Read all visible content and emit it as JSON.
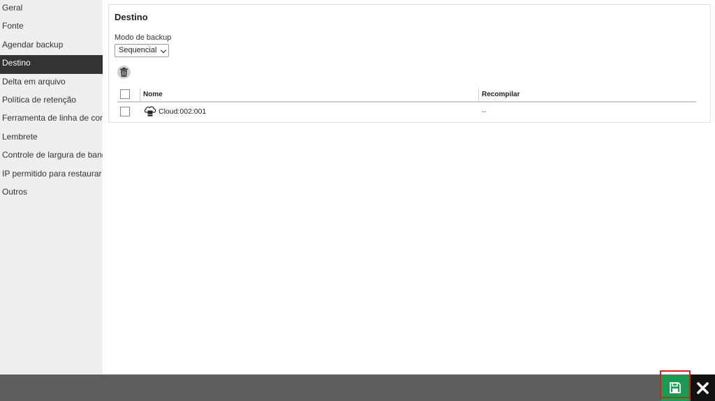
{
  "sidebar": {
    "items": [
      {
        "label": "Geral",
        "active": false
      },
      {
        "label": "Fonte",
        "active": false
      },
      {
        "label": "Agendar backup",
        "active": false
      },
      {
        "label": "Destino",
        "active": true
      },
      {
        "label": "Delta em arquivo",
        "active": false
      },
      {
        "label": "Política de retenção",
        "active": false
      },
      {
        "label": "Ferramenta de linha de coma",
        "active": false
      },
      {
        "label": "Lembrete",
        "active": false
      },
      {
        "label": "Controle de largura de band",
        "active": false
      },
      {
        "label": "IP permitido para restaurar",
        "active": false
      },
      {
        "label": "Outros",
        "active": false
      }
    ]
  },
  "panel": {
    "title": "Destino",
    "mode_label": "Modo de backup",
    "mode_value": "Sequencial"
  },
  "table": {
    "columns": {
      "name": "Nome",
      "recompile": "Recompilar"
    },
    "rows": [
      {
        "name": "Cloud:002:001",
        "recompile": "--"
      }
    ]
  },
  "icons": {
    "delete": "trash-icon",
    "destination": "cloud-storage-icon",
    "save": "floppy-disk-icon",
    "close": "close-x-icon"
  },
  "colors": {
    "sidebar_active_bg": "#333333",
    "save_green": "#1a9a52",
    "highlight_red": "#e11b1b",
    "footer_bg": "#5e5e5e"
  }
}
